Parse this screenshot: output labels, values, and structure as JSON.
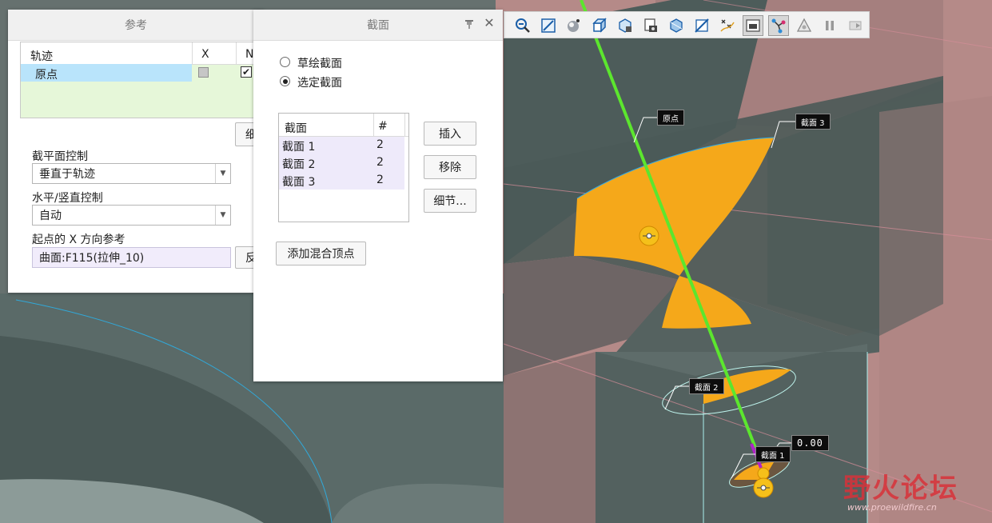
{
  "left_panel": {
    "title": "参考",
    "table": {
      "headers": [
        "轨迹",
        "X",
        "N"
      ],
      "rows": [
        {
          "name": "原点",
          "x_checked": false,
          "n_checked": true
        }
      ]
    },
    "details_button_partial": "细",
    "section_control": {
      "label": "截平面控制",
      "value": "垂直于轨迹"
    },
    "hv_control": {
      "label": "水平/竖直控制",
      "value": "自动"
    },
    "x_ref": {
      "label": "起点的 X 方向参考",
      "value": "曲面:F115(拉伸_10)",
      "button_partial": "反"
    }
  },
  "sections_panel": {
    "title": "截面",
    "options": [
      {
        "label": "草绘截面",
        "selected": false
      },
      {
        "label": "选定截面",
        "selected": true
      }
    ],
    "table": {
      "headers": [
        "截面",
        "#"
      ],
      "rows": [
        {
          "name": "截面 1",
          "count": "2"
        },
        {
          "name": "截面 2",
          "count": "2"
        },
        {
          "name": "截面 3",
          "count": "2"
        }
      ]
    },
    "insert_label": "插入",
    "remove_label": "移除",
    "details_label": "细节...",
    "add_blend_vertex_label": "添加混合顶点"
  },
  "viewport": {
    "callouts": {
      "origin": "原点",
      "section3": "截面 3",
      "section2": "截面 2",
      "section1": "截面 1",
      "value": "0.00"
    },
    "watermark": {
      "text": "野火论坛",
      "url": "www.proewildfire.cn"
    },
    "colors": {
      "trajectory": "#5ce62e",
      "section_fill": "#f5a81a",
      "model": "#5a6b69",
      "part": "#a8807f"
    }
  },
  "toolbar": {
    "icons": [
      "zoom-out-icon",
      "refit-icon",
      "shading-icon",
      "box-icon",
      "saved-views-icon",
      "view-manager-icon",
      "display-style-icon",
      "plane-display-icon",
      "point-display-icon",
      "spin-center-icon",
      "annotation-display-icon",
      "triangle-icon",
      "pause-icon",
      "forward-icon"
    ]
  }
}
